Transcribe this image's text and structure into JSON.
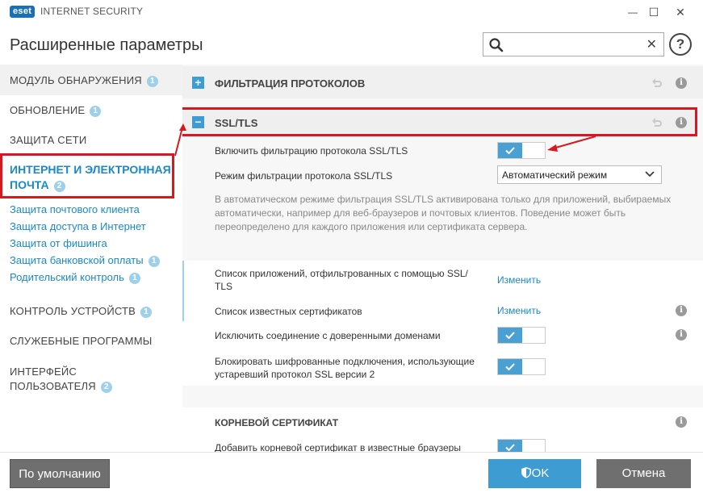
{
  "window": {
    "logo_text": "eset",
    "app_title": "INTERNET SECURITY",
    "minimize_glyph": "—",
    "maximize_glyph": "☐",
    "close_glyph": "✕"
  },
  "header": {
    "title": "Расширенные параметры",
    "search": {
      "value": "",
      "placeholder": "",
      "clear_glyph": "✕"
    },
    "help_glyph": "?"
  },
  "sidebar": {
    "items": [
      {
        "label": "МОДУЛЬ ОБНАРУЖЕНИЯ",
        "badge": "1"
      },
      {
        "label": "ОБНОВЛЕНИЕ",
        "badge": "1"
      },
      {
        "label": "ЗАЩИТА СЕТИ",
        "badge": ""
      },
      {
        "label": "ИНТЕРНЕТ И ЭЛЕКТРОННАЯ ПОЧТА",
        "badge": "2"
      },
      {
        "label": "КОНТРОЛЬ УСТРОЙСТВ",
        "badge": "1"
      },
      {
        "label": "СЛУЖЕБНЫЕ ПРОГРАММЫ",
        "badge": ""
      },
      {
        "label": "ИНТЕРФЕЙС ПОЛЬЗОВАТЕЛЯ",
        "badge": "2"
      }
    ],
    "web_label_line1": "ИНТЕРНЕТ И ЭЛЕКТРОННАЯ",
    "web_label_line2": "ПОЧТА",
    "sublinks": [
      {
        "label": "Защита почтового клиента",
        "badge": ""
      },
      {
        "label": "Защита доступа в Интернет",
        "badge": ""
      },
      {
        "label": "Защита от фишинга",
        "badge": ""
      },
      {
        "label": "Защита банковской оплаты",
        "badge": "1"
      },
      {
        "label": "Родительский контроль",
        "badge": "1"
      }
    ]
  },
  "content": {
    "sections": [
      {
        "title": "ФИЛЬТРАЦИЯ ПРОТОКОЛОВ",
        "toggle_glyph": "+"
      },
      {
        "title": "SSL/TLS",
        "toggle_glyph": "−"
      }
    ],
    "enable_ssl_label": "Включить фильтрацию протокола SSL/TLS",
    "enable_ssl_on": true,
    "mode_label": "Режим фильтрации протокола SSL/TLS",
    "mode_value": "Автоматический режим",
    "description": "В автоматическом режиме фильтрация SSL/TLS активирована только для приложений, выбираемых автоматически, например для веб-браузеров и почтовых клиентов. Поведение может быть переопределено для каждого приложения или сертификата сервера.",
    "app_list_label": "Список приложений, отфильтрованных с помощью SSL/TLS",
    "app_list_label_line1": "Список приложений, отфильтрованных с помощью SSL/",
    "app_list_label_line2": "TLS",
    "app_list_link": "Изменить",
    "known_certs_label": "Список известных сертификатов",
    "known_certs_link": "Изменить",
    "exclude_trusted_label": "Исключить соединение с доверенными доменами",
    "exclude_trusted_on": true,
    "block_ssl2_label_line1": "Блокировать шифрованные подключения, использующие",
    "block_ssl2_label_line2": "устаревший протокол SSL версии 2",
    "block_ssl2_on": true,
    "root_cert_title": "КОРНЕВОЙ СЕРТИФИКАТ",
    "add_root_label": "Добавить корневой сертификат в известные браузеры",
    "add_root_on": true,
    "info_glyph": "i"
  },
  "footer": {
    "default_label": "По умолчанию",
    "ok_label": "OK",
    "cancel_label": "Отмена"
  },
  "colors": {
    "accent": "#3d9cd2",
    "link": "#1a8ac6",
    "highlight_red": "#d7181f",
    "button_gray": "#6f6f6f"
  }
}
